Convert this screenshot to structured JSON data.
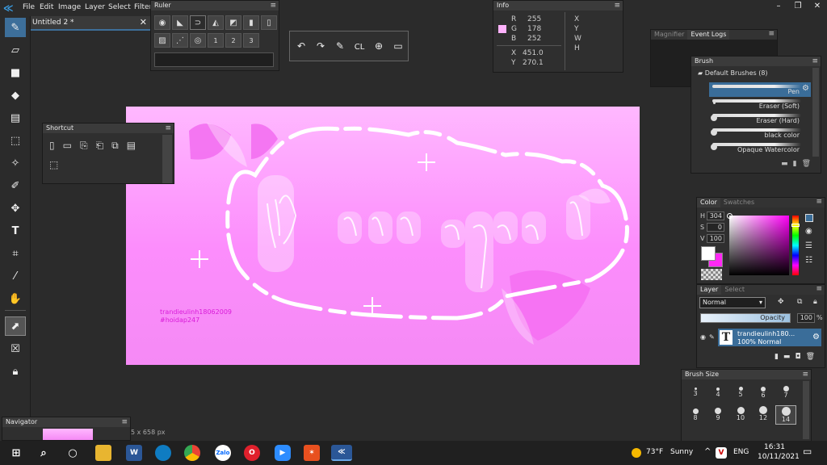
{
  "menubar": {
    "items": [
      "File",
      "Edit",
      "Image",
      "Layer",
      "Select",
      "Filter"
    ],
    "window_controls": [
      "–",
      "❐",
      "✕"
    ]
  },
  "document_tab": {
    "title": "Untitled 2 *",
    "close": "✕"
  },
  "ruler_panel": {
    "title": "Ruler",
    "numbers": [
      "1",
      "2",
      "3"
    ]
  },
  "quickbar": {
    "clear_label": "CL"
  },
  "info_panel": {
    "title": "Info",
    "r_label": "R",
    "r": "255",
    "g_label": "G",
    "g": "178",
    "b_label": "B",
    "b": "252",
    "x_label": "X",
    "x": "451.0",
    "y_label": "Y",
    "y": "270.1",
    "xywh_labels": [
      "X",
      "Y",
      "W",
      "H"
    ]
  },
  "magnifier": {
    "tabs": [
      "Magnifier",
      "Event Logs"
    ]
  },
  "brush_panel": {
    "title": "Brush",
    "group": "Default Brushes (8)",
    "brushes": [
      "Pen",
      "Eraser (Soft)",
      "Eraser (Hard)",
      "black color",
      "Opaque Watercolor"
    ]
  },
  "color_panel": {
    "tabs": [
      "Color",
      "Swatches"
    ],
    "h_label": "H",
    "h": "304",
    "s_label": "S",
    "s": "0",
    "v_label": "V",
    "v": "100",
    "fg_color": "#ffffff",
    "bg_color": "#ff28f4"
  },
  "layer_panel": {
    "tabs": [
      "Layer",
      "Select"
    ],
    "blend_mode": "Normal",
    "opacity_label": "Opacity",
    "opacity": "100",
    "opacity_unit": "%",
    "layer_name": "trandieulinh180...",
    "layer_info": "100% Normal",
    "layer_type_glyph": "T"
  },
  "brush_size": {
    "title": "Brush Size",
    "sizes": [
      "3",
      "4",
      "5",
      "6",
      "7",
      "8",
      "9",
      "10",
      "12",
      "14"
    ],
    "selected": "14"
  },
  "shortcut_panel": {
    "title": "Shortcut"
  },
  "navigator": {
    "title": "Navigator",
    "canvas_size": "5 x 658 px"
  },
  "canvas": {
    "text_line1": "trandieulinh18062009",
    "text_line2": "#hoidap247",
    "accent": "#d81bd8"
  },
  "taskbar": {
    "weather_temp": "73°F",
    "weather_desc": "Sunny",
    "language": "ENG",
    "time": "16:31",
    "date": "10/11/2021"
  }
}
